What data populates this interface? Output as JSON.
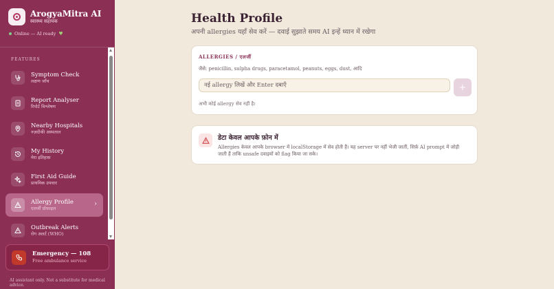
{
  "brand": {
    "title": "ArogyaMitra AI",
    "subtitle": "स्वास्थ्य सहायक",
    "status": "Online — AI ready"
  },
  "sidebar": {
    "section_label": "FEATURES",
    "items": [
      {
        "label": "Symptom Check",
        "sub": "लक्षण जाँच",
        "icon": "stethoscope-icon"
      },
      {
        "label": "Report Analyser",
        "sub": "रिपोर्ट विश्लेषण",
        "icon": "document-icon"
      },
      {
        "label": "Nearby Hospitals",
        "sub": "नज़दीकी अस्पताल",
        "icon": "map-pin-icon"
      },
      {
        "label": "My History",
        "sub": "मेरा इतिहास",
        "icon": "history-icon"
      },
      {
        "label": "First Aid Guide",
        "sub": "प्राथमिक उपचार",
        "icon": "sparkle-icon"
      },
      {
        "label": "Allergy Profile",
        "sub": "एलर्जी प्रोफ़ाइल",
        "icon": "warning-icon",
        "active": true
      },
      {
        "label": "Outbreak Alerts",
        "sub": "रोग अलर्ट (WHO)",
        "icon": "alert-icon"
      }
    ],
    "emergency": {
      "title": "Emergency — 108",
      "subtitle": "Free ambulance service"
    },
    "disclaimer": "AI assistant only. Not a substitute for medical advice."
  },
  "main": {
    "title": "Health Profile",
    "subtitle": "अपनी allergies यहाँ सेव करें — दवाई सुझाते समय AI इन्हें ध्यान में रखेगा",
    "allergy_card": {
      "label": "ALLERGIES / एलर्जी",
      "hint": "जैसे: penicillin, sulpha drugs, paracetamol, peanuts, eggs, dust, आदि",
      "input_placeholder": "नई allergy लिखें और Enter दबाएँ",
      "add_label": "+",
      "empty_note": "अभी कोई allergy सेव नहीं है।"
    },
    "info_card": {
      "title": "डेटा केवल आपके फ़ोन में",
      "body": "Allergies केवल आपके browser में localStorage में सेव होती हैं। यह server पर नहीं भेजी जातीं, सिर्फ़ AI prompt में जोड़ी जाती हैं ताकि unsafe दवाइयों को flag किया जा सके।"
    }
  },
  "colors": {
    "sidebar": "#8b2f55",
    "active_item": "#b8678a",
    "background": "#f0e9dc",
    "emergency": "#c0392b"
  }
}
